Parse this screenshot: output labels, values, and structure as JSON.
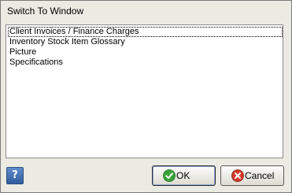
{
  "window": {
    "title": "Switch To Window"
  },
  "list": {
    "items": [
      {
        "label": "Client Invoices / Finance Charges",
        "selected": true
      },
      {
        "label": "Inventory Stock Item Glossary",
        "selected": false
      },
      {
        "label": "Picture",
        "selected": false
      },
      {
        "label": "Specifications",
        "selected": false
      }
    ]
  },
  "buttons": {
    "help_glyph": "?",
    "help_icon": "help-icon",
    "ok_label": "OK",
    "ok_icon": "check-icon",
    "cancel_label": "Cancel",
    "cancel_icon": "x-icon"
  },
  "colors": {
    "dialog_bg": "#ebeae3",
    "ok_icon_green": "#3aa23a",
    "cancel_icon_red": "#d23a2a",
    "help_blue": "#2f5b9c"
  }
}
